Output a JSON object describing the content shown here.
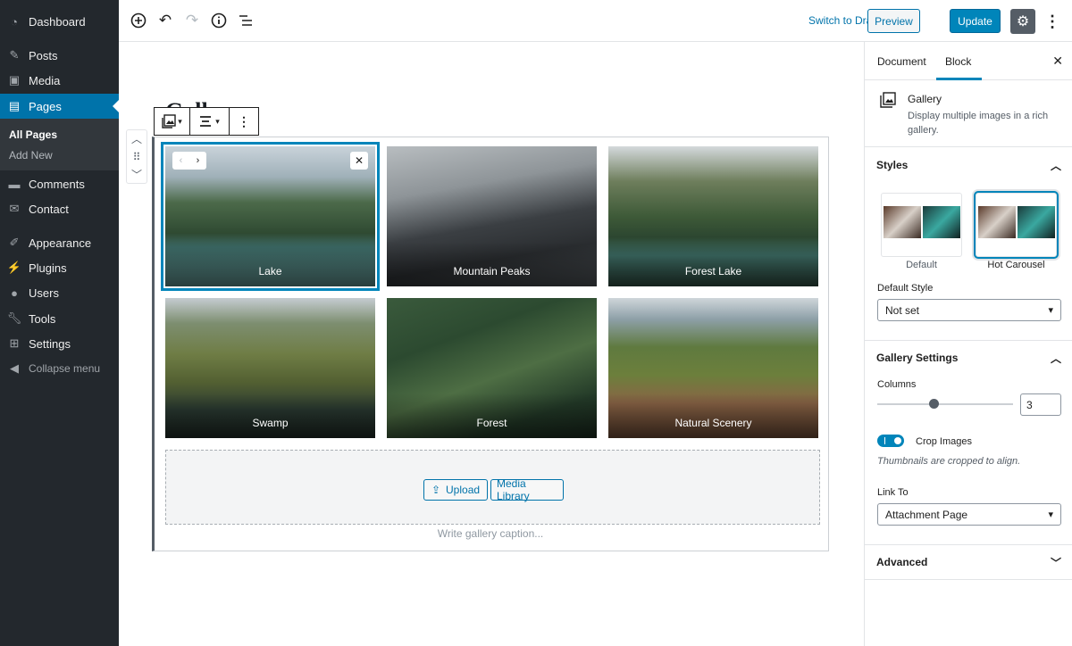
{
  "admin_menu": {
    "dashboard": "Dashboard",
    "posts": "Posts",
    "media": "Media",
    "pages": "Pages",
    "all_pages": "All Pages",
    "add_new": "Add New",
    "comments": "Comments",
    "contact": "Contact",
    "appearance": "Appearance",
    "plugins": "Plugins",
    "users": "Users",
    "tools": "Tools",
    "settings": "Settings",
    "collapse": "Collapse menu"
  },
  "toolbar": {
    "switch_to_draft": "Switch to Draft",
    "preview": "Preview",
    "update": "Update"
  },
  "editor": {
    "page_title": "Gallery",
    "upload_label": "Upload",
    "media_library_label": "Media Library",
    "caption_placeholder": "Write gallery caption..."
  },
  "gallery": {
    "images": [
      {
        "caption": "Lake"
      },
      {
        "caption": "Mountain Peaks"
      },
      {
        "caption": "Forest Lake"
      },
      {
        "caption": "Swamp"
      },
      {
        "caption": "Forest"
      },
      {
        "caption": "Natural Scenery"
      }
    ]
  },
  "sidebar": {
    "tab_document": "Document",
    "tab_block": "Block",
    "block_name": "Gallery",
    "block_description": "Display multiple images in a rich gallery.",
    "styles_title": "Styles",
    "style_default": "Default",
    "style_hot_carousel": "Hot Carousel",
    "default_style_label": "Default Style",
    "default_style_value": "Not set",
    "gallery_settings_title": "Gallery Settings",
    "columns_label": "Columns",
    "columns_value": "3",
    "crop_images_label": "Crop Images",
    "crop_images_help": "Thumbnails are cropped to align.",
    "link_to_label": "Link To",
    "link_to_value": "Attachment Page",
    "advanced_title": "Advanced"
  },
  "colors": {
    "admin_bg": "#23282d",
    "accent": "#0085ba",
    "link": "#0073aa"
  }
}
